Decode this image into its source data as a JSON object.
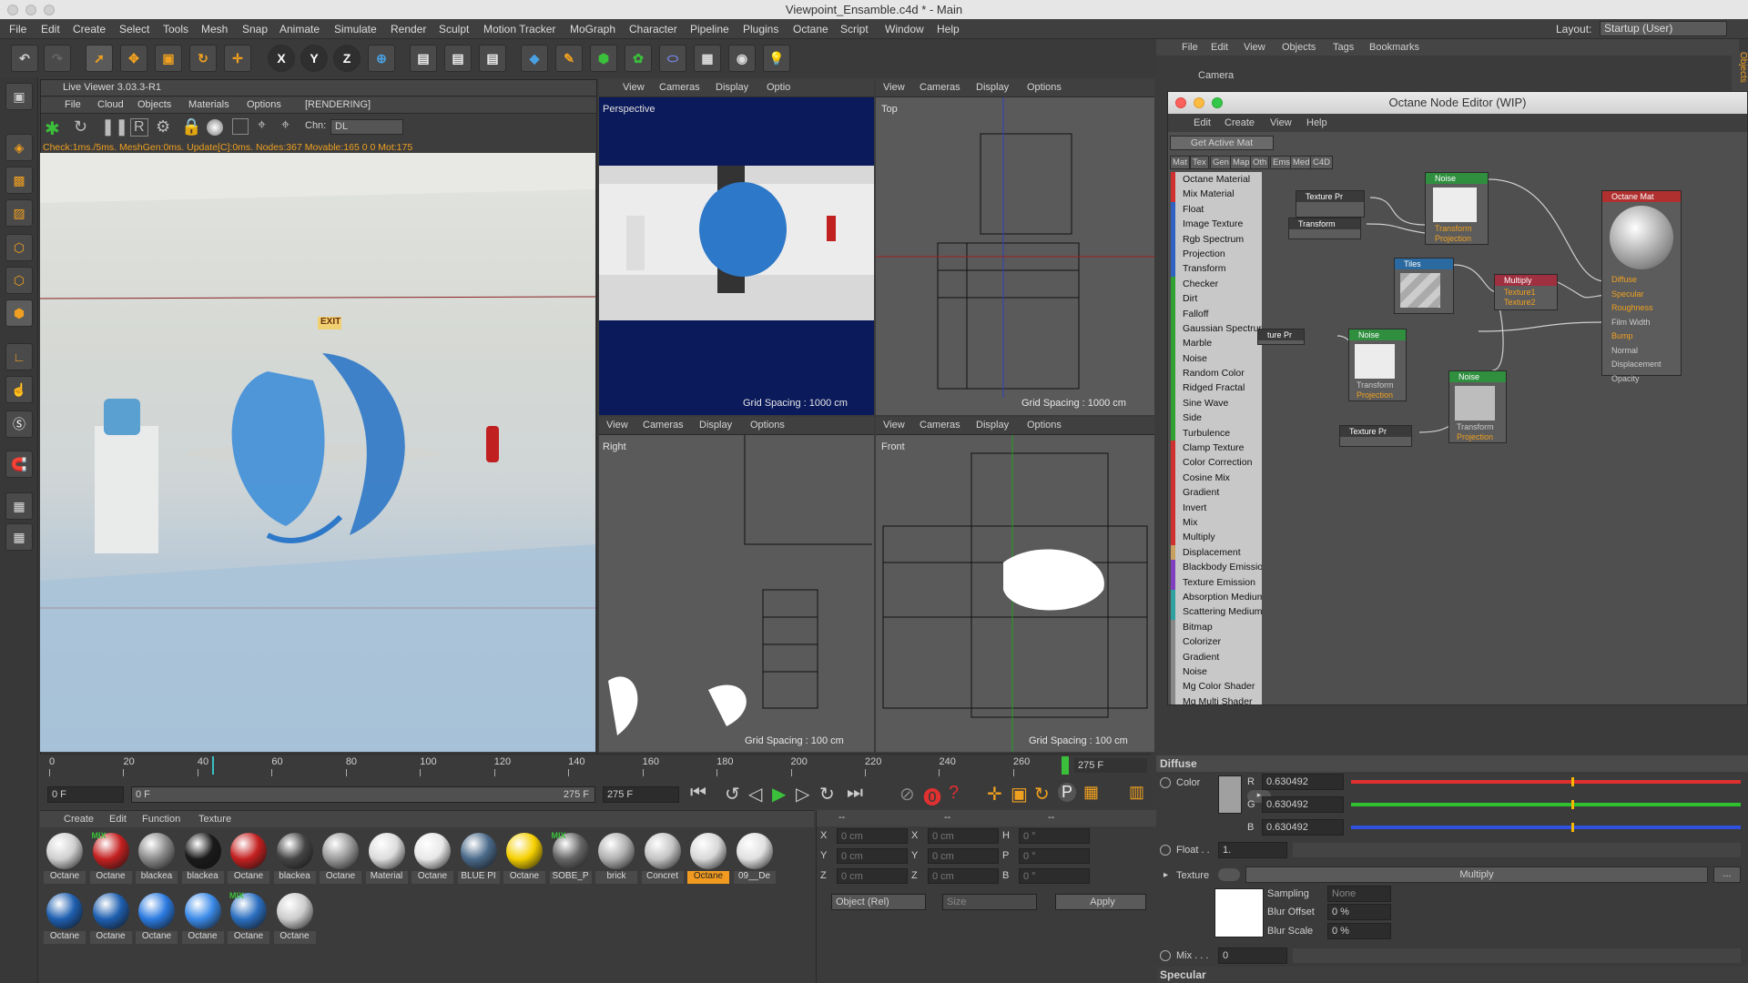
{
  "window": {
    "title": "Viewpoint_Ensamble.c4d * - Main",
    "layout_label": "Layout:",
    "layout_value": "Startup (User)"
  },
  "menu": [
    "File",
    "Edit",
    "Create",
    "Select",
    "Tools",
    "Mesh",
    "Snap",
    "Animate",
    "Simulate",
    "Render",
    "Sculpt",
    "Motion Tracker",
    "MoGraph",
    "Character",
    "Pipeline",
    "Plugins",
    "Octane",
    "Script",
    "Window",
    "Help"
  ],
  "live_viewer": {
    "title": "Live Viewer 3.03.3-R1",
    "menu": [
      "File",
      "Cloud",
      "Objects",
      "Materials",
      "Options"
    ],
    "status": "[RENDERING]",
    "chn_label": "Chn:",
    "chn_value": "DL",
    "info": "Check:1ms./5ms. MeshGen:0ms. Update[C]:0ms. Nodes:367 Movable:165  0 0 Mot:175",
    "exit_sign": "EXIT"
  },
  "viewport_menu": [
    "View",
    "Cameras",
    "Display",
    "Options"
  ],
  "viewports": {
    "perspective": "Perspective",
    "top": "Top",
    "right": "Right",
    "front": "Front",
    "grid_1000": "Grid Spacing : 1000 cm",
    "grid_100": "Grid Spacing : 100 cm",
    "optio": "Optio"
  },
  "timeline": {
    "ticks": [
      "0",
      "20",
      "40",
      "60",
      "80",
      "100",
      "120",
      "140",
      "160",
      "180",
      "200",
      "220",
      "240",
      "260"
    ],
    "end": "275 F",
    "cur_frame": "0 F",
    "range_start": "0 F",
    "range_end": "275 F",
    "field_end": "275 F",
    "playhead_frac": 0.16
  },
  "material_manager": {
    "menu": [
      "Create",
      "Edit",
      "Function",
      "Texture"
    ],
    "row1": [
      {
        "name": "Octane",
        "color": "#cfcfcf"
      },
      {
        "name": "Octane",
        "color": "#c42020",
        "mix": true
      },
      {
        "name": "blackea",
        "color": "#8a8a8a"
      },
      {
        "name": "blackea",
        "color": "#1a1a1a"
      },
      {
        "name": "Octane",
        "color": "#c42020"
      },
      {
        "name": "blackea",
        "color": "#444444"
      },
      {
        "name": "Octane",
        "color": "#9a9a9a"
      },
      {
        "name": "Material",
        "color": "#dcdcdc"
      },
      {
        "name": "Octane",
        "color": "#e8e8e8"
      },
      {
        "name": "BLUE PI",
        "color": "#4a6a8a"
      },
      {
        "name": "Octane",
        "color": "#f5d000"
      },
      {
        "name": "SOBE_P",
        "color": "#666666",
        "mix": true
      },
      {
        "name": "brick",
        "color": "#b0b0b0"
      },
      {
        "name": "Concret",
        "color": "#c4c4c4"
      },
      {
        "name": "Octane",
        "color": "#d8d8d8",
        "selected": true
      },
      {
        "name": "09__De",
        "color": "#e0e0e0"
      }
    ],
    "row2": [
      {
        "name": "Octane",
        "color": "#1e5fb0"
      },
      {
        "name": "Octane",
        "color": "#1e5fb0"
      },
      {
        "name": "Octane",
        "color": "#2b7ae0"
      },
      {
        "name": "Octane",
        "color": "#3a8ae8"
      },
      {
        "name": "Octane",
        "color": "#2b6fc0",
        "mix": true
      },
      {
        "name": "Octane",
        "color": "#cccccc"
      }
    ],
    "mix_label": "MIX"
  },
  "coords": {
    "rows": [
      [
        "X",
        "0 cm",
        "X",
        "0 cm",
        "H",
        "0 °"
      ],
      [
        "Y",
        "0 cm",
        "Y",
        "0 cm",
        "P",
        "0 °"
      ],
      [
        "Z",
        "0 cm",
        "Z",
        "0 cm",
        "B",
        "0 °"
      ]
    ],
    "mode": "Object (Rel)",
    "size": "Size",
    "apply": "Apply",
    "dashes": [
      "--",
      "--",
      "--"
    ]
  },
  "object_manager": {
    "menu": [
      "File",
      "Edit",
      "View",
      "Objects",
      "Tags",
      "Bookmarks"
    ],
    "item": "Camera",
    "side_tab": "Objects"
  },
  "node_editor": {
    "title": "Octane Node Editor (WIP)",
    "menu": [
      "Edit",
      "Create",
      "View",
      "Help"
    ],
    "get_active": "Get Active Mat",
    "tabs": [
      "Mat",
      "Tex",
      "Gen",
      "Map",
      "Oth",
      "Ems",
      "Med",
      "C4D"
    ],
    "list": [
      {
        "t": "Octane Material",
        "c": "#d03030"
      },
      {
        "t": "Mix Material",
        "c": "#d03030"
      },
      {
        "t": "Float",
        "c": "#3060c0"
      },
      {
        "t": "Image Texture",
        "c": "#3060c0"
      },
      {
        "t": "Rgb Spectrum",
        "c": "#3060c0"
      },
      {
        "t": "Projection",
        "c": "#3060c0"
      },
      {
        "t": "Transform",
        "c": "#3060c0"
      },
      {
        "t": "Checker",
        "c": "#30a030"
      },
      {
        "t": "Dirt",
        "c": "#30a030"
      },
      {
        "t": "Falloff",
        "c": "#30a030"
      },
      {
        "t": "Gaussian Spectrum",
        "c": "#30a030"
      },
      {
        "t": "Marble",
        "c": "#30a030"
      },
      {
        "t": "Noise",
        "c": "#30a030"
      },
      {
        "t": "Random Color",
        "c": "#30a030"
      },
      {
        "t": "Ridged Fractal",
        "c": "#30a030"
      },
      {
        "t": "Sine Wave",
        "c": "#30a030"
      },
      {
        "t": "Side",
        "c": "#30a030"
      },
      {
        "t": "Turbulence",
        "c": "#30a030"
      },
      {
        "t": "Clamp Texture",
        "c": "#d03030"
      },
      {
        "t": "Color Correction",
        "c": "#d03030"
      },
      {
        "t": "Cosine Mix",
        "c": "#d03030"
      },
      {
        "t": "Gradient",
        "c": "#d03030"
      },
      {
        "t": "Invert",
        "c": "#d03030"
      },
      {
        "t": "Mix",
        "c": "#d03030"
      },
      {
        "t": "Multiply",
        "c": "#d03030"
      },
      {
        "t": "Displacement",
        "c": "#c8a060"
      },
      {
        "t": "Blackbody Emission",
        "c": "#8040c0"
      },
      {
        "t": "Texture Emission",
        "c": "#8040c0"
      },
      {
        "t": "Absorption Medium",
        "c": "#30a0a0"
      },
      {
        "t": "Scattering Medium",
        "c": "#30a0a0"
      },
      {
        "t": "Bitmap",
        "c": "#888888"
      },
      {
        "t": "Colorizer",
        "c": "#888888"
      },
      {
        "t": "Gradient",
        "c": "#888888"
      },
      {
        "t": "Noise",
        "c": "#888888"
      },
      {
        "t": "Mg Color Shader",
        "c": "#888888"
      },
      {
        "t": "Mg Multi Shader",
        "c": "#888888"
      }
    ],
    "nodes": {
      "texpr1": "Texture Pr",
      "transform": "Transform",
      "noise1": "Noise",
      "noise1_ports": [
        "Transform",
        "Projection"
      ],
      "tiles": "Tiles",
      "multiply": "Multiply",
      "multiply_ports": [
        "Texture1",
        "Texture2"
      ],
      "octmat": "Octane Mat",
      "octmat_ports": [
        "Diffuse",
        "Specular",
        "Roughness",
        "Film Width",
        "Bump",
        "Normal",
        "Displacement",
        "Opacity"
      ],
      "texpr2": "ture Pr",
      "noise2": "Noise",
      "noise2_ports": [
        "Transform",
        "Projection"
      ],
      "noise3": "Noise",
      "noise3_ports": [
        "Transform",
        "Projection"
      ],
      "texpr3": "Texture Pr"
    }
  },
  "attributes": {
    "section": "Diffuse",
    "color_label": "Color",
    "r_label": "R",
    "g_label": "G",
    "b_label": "B",
    "r": "0.630492",
    "g": "0.630492",
    "b": "0.630492",
    "float_label": "Float . .",
    "float_val": "1.",
    "texture_label": "Texture",
    "texture_val": "Multiply",
    "texture_btn": "...",
    "sampling_label": "Sampling",
    "sampling_val": "None",
    "blur_offset_label": "Blur Offset",
    "blur_offset_val": "0 %",
    "blur_scale_label": "Blur Scale",
    "blur_scale_val": "0 %",
    "mix_label": "Mix . . .",
    "mix_val": "0",
    "next_section": "Specular"
  }
}
